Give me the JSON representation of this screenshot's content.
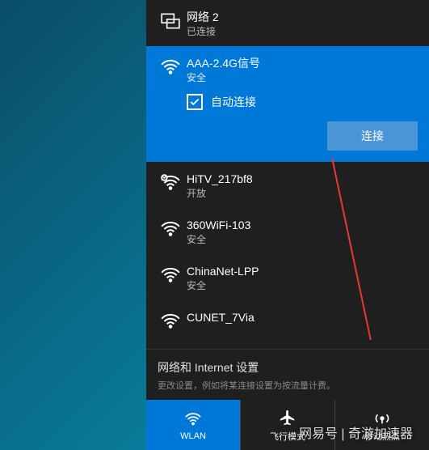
{
  "ethernet": {
    "name": "网络 2",
    "status": "已连接"
  },
  "selected_network": {
    "name": "AAA-2.4G信号",
    "status": "安全",
    "auto_connect_label": "自动连接",
    "connect_btn": "连接"
  },
  "networks": [
    {
      "name": "HiTV_217bf8",
      "status": "开放",
      "secured": false
    },
    {
      "name": "360WiFi-103",
      "status": "安全",
      "secured": true
    },
    {
      "name": "ChinaNet-LPP",
      "status": "安全",
      "secured": true
    },
    {
      "name": "CUNET_7Via",
      "status": "",
      "secured": true
    }
  ],
  "settings": {
    "title": "网络和 Internet 设置",
    "desc": "更改设置，例如将某连接设置为按流量计费。"
  },
  "tabs": {
    "wlan": "WLAN",
    "airplane": "飞行模式",
    "hotspot": "移动热点"
  },
  "watermark": "网易号 | 奇游加速器"
}
